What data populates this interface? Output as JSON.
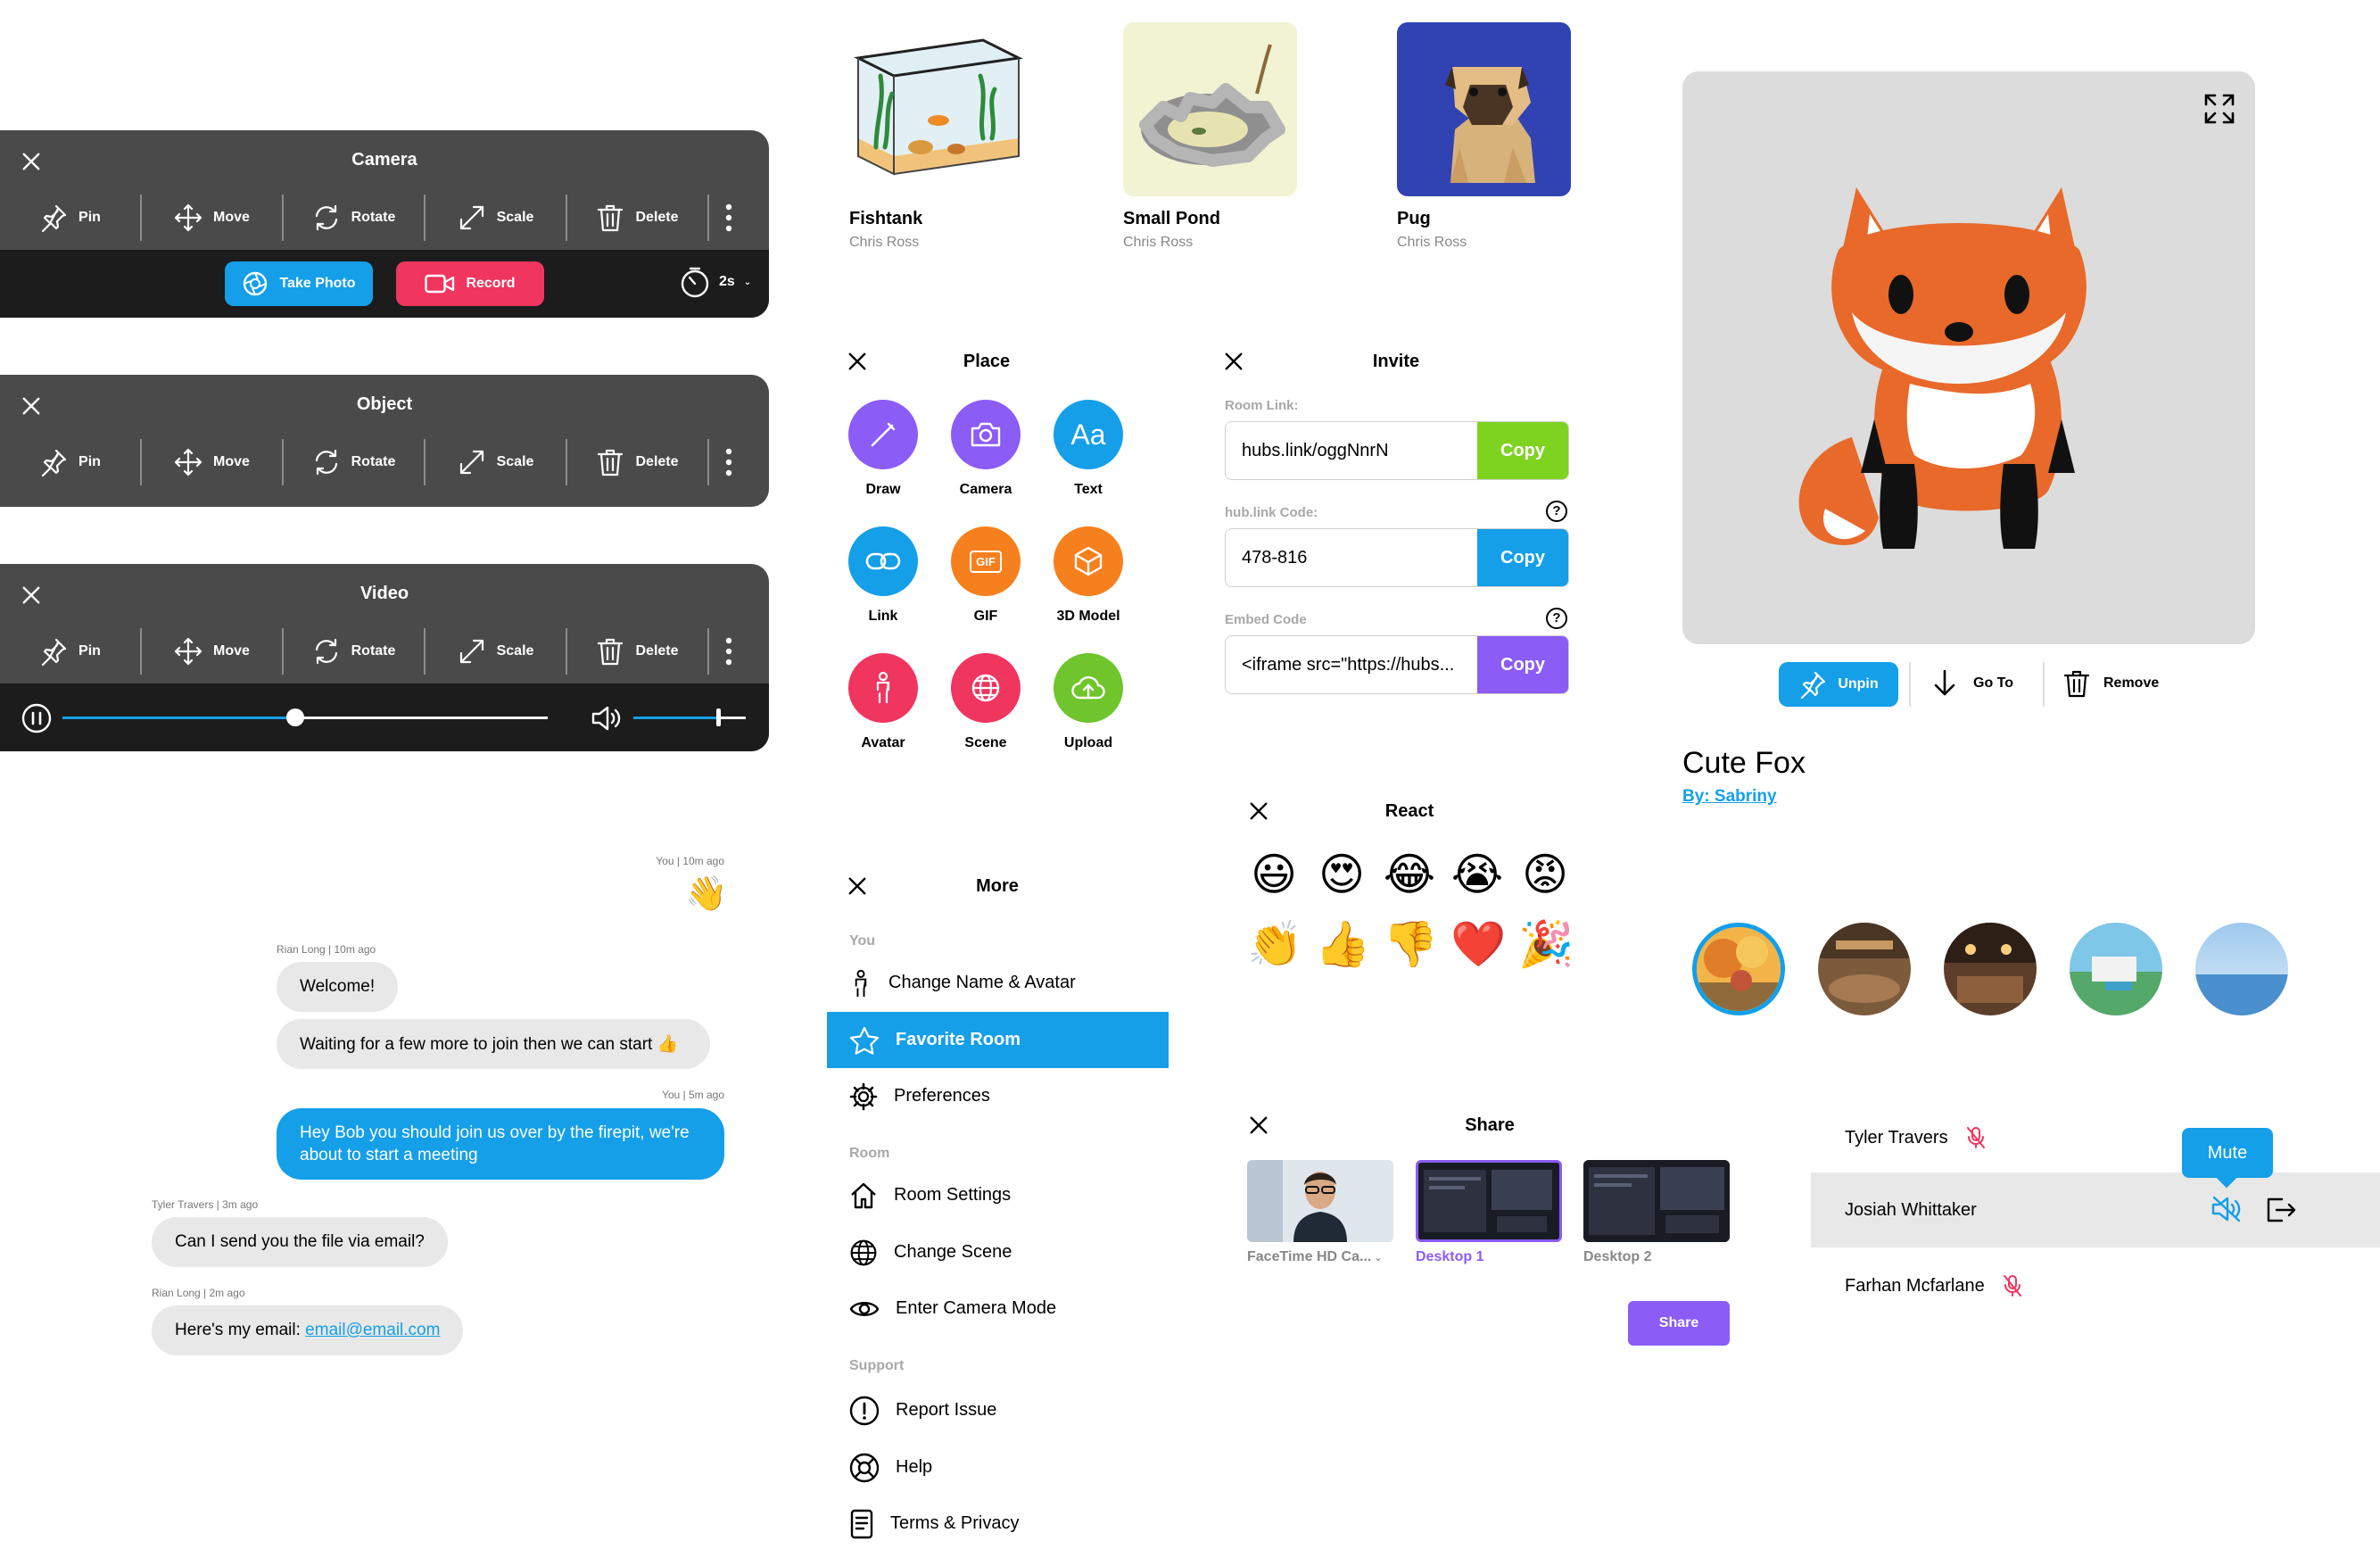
{
  "toolbar_actions": {
    "pin": "Pin",
    "move": "Move",
    "rotate": "Rotate",
    "scale": "Scale",
    "delete": "Delete"
  },
  "camera": {
    "title": "Camera",
    "take_photo": "Take Photo",
    "record": "Record",
    "timer": "2s"
  },
  "object": {
    "title": "Object"
  },
  "video": {
    "title": "Video",
    "progress": 0.48,
    "volume": 0.75
  },
  "assets": [
    {
      "title": "Fishtank",
      "author": "Chris Ross"
    },
    {
      "title": "Small Pond",
      "author": "Chris Ross"
    },
    {
      "title": "Pug",
      "author": "Chris Ross"
    }
  ],
  "place": {
    "title": "Place",
    "items": [
      {
        "label": "Draw",
        "color": "#8b5cf6"
      },
      {
        "label": "Camera",
        "color": "#8b5cf6"
      },
      {
        "label": "Text",
        "color": "#149fe8"
      },
      {
        "label": "Link",
        "color": "#149fe8"
      },
      {
        "label": "GIF",
        "color": "#f7801e"
      },
      {
        "label": "3D Model",
        "color": "#f7801e"
      },
      {
        "label": "Avatar",
        "color": "#f0355f"
      },
      {
        "label": "Scene",
        "color": "#f0355f"
      },
      {
        "label": "Upload",
        "color": "#6fc52b"
      }
    ]
  },
  "invite": {
    "title": "Invite",
    "room_link_label": "Room Link:",
    "room_link": "hubs.link/oggNnrN",
    "code_label": "hub.link Code:",
    "code": "478-816",
    "embed_label": "Embed Code",
    "embed": "<iframe src=\"https://hubs...",
    "copy": "Copy",
    "copy_colors": [
      "#7ed321",
      "#149fe8",
      "#8b5cf6"
    ]
  },
  "more": {
    "title": "More",
    "sec_you": "You",
    "sec_room": "Room",
    "sec_support": "Support",
    "items": [
      "Change Name & Avatar",
      "Favorite Room",
      "Preferences",
      "Room Settings",
      "Change Scene",
      "Enter Camera Mode",
      "Report Issue",
      "Help",
      "Terms & Privacy"
    ]
  },
  "chat": [
    {
      "meta": "You  |  10m ago",
      "text": "👋"
    },
    {
      "meta": "Rian Long  |  10m ago",
      "text": "Welcome!"
    },
    {
      "text": "Waiting for a few more to join then we can start 👍"
    },
    {
      "meta": "You  |  5m ago",
      "text": "Hey Bob you should join us over by the firepit, we're about to start a meeting"
    },
    {
      "meta": "Tyler Travers  |  3m ago",
      "text": "Can I send you the file via email?"
    },
    {
      "meta": "Rian Long  |  2m ago",
      "text": "Here's my email: ",
      "link": "email@email.com"
    }
  ],
  "react": {
    "title": "React",
    "emojis": [
      "😃",
      "😍",
      "😂",
      "😭",
      "😡",
      "👏",
      "👍",
      "👎",
      "❤️",
      "🎉"
    ]
  },
  "share": {
    "title": "Share",
    "sources": [
      "FaceTime HD Ca...",
      "Desktop 1",
      "Desktop 2"
    ],
    "button": "Share"
  },
  "fox": {
    "unpin": "Unpin",
    "goto": "Go To",
    "remove": "Remove",
    "name": "Cute Fox",
    "author": "By: Sabriny"
  },
  "people": {
    "list": [
      "Tyler Travers",
      "Josiah Whittaker",
      "Farhan Mcfarlane"
    ],
    "tooltip": "Mute"
  }
}
